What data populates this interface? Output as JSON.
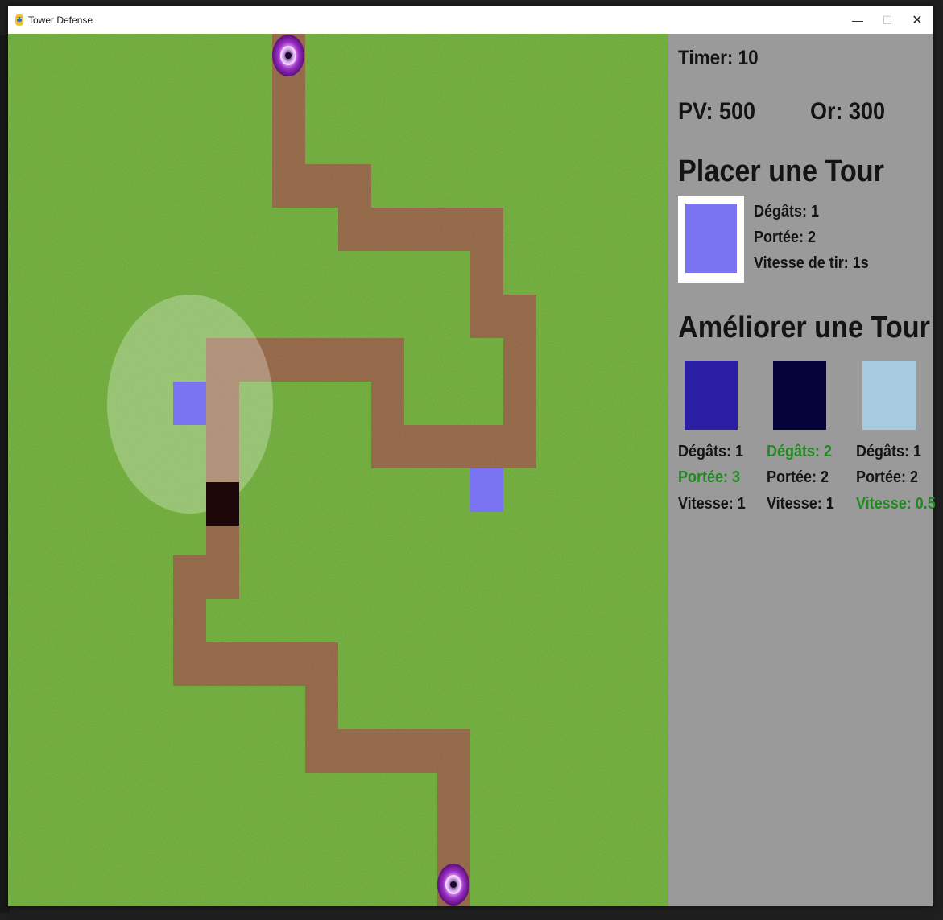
{
  "window": {
    "title": "Tower Defense",
    "minimize_symbol": "—",
    "maximize_symbol": "☐",
    "close_symbol": "✕"
  },
  "hud": {
    "timer": "Timer: 10",
    "hp": "PV: 500",
    "gold": "Or: 300"
  },
  "place_tower": {
    "title": "Placer une Tour",
    "damage": "Dégâts: 1",
    "range": "Portée: 2",
    "fire_rate": "Vitesse de tir: 1s",
    "color": "#7b74f2"
  },
  "upgrade_tower": {
    "title": "Améliorer une Tour",
    "options": [
      {
        "color": "#2a1fa3",
        "damage": "Dégâts: 1",
        "range": "Portée: 3",
        "speed": "Vitesse: 1",
        "highlight": "range"
      },
      {
        "color": "#05033a",
        "damage": "Dégâts: 2",
        "range": "Portée: 2",
        "speed": "Vitesse: 1",
        "highlight": "damage"
      },
      {
        "color": "#a7cce0",
        "damage": "Dégâts: 1",
        "range": "Portée: 2",
        "speed": "Vitesse: 0.5",
        "highlight": "speed"
      }
    ]
  },
  "colors": {
    "grass": "#5f9e2c",
    "path": "#8b5e3c",
    "panel": "#9a9a9a",
    "tower": "#7b74f2",
    "enemy": "#1c0808",
    "portal": "#9b2fc4",
    "highlight_text": "#1f8a1f"
  },
  "icons": {
    "spawn_portal": "purple-portal-icon",
    "exit_portal": "purple-portal-icon",
    "app_icon": "pygame-snake-icon"
  }
}
